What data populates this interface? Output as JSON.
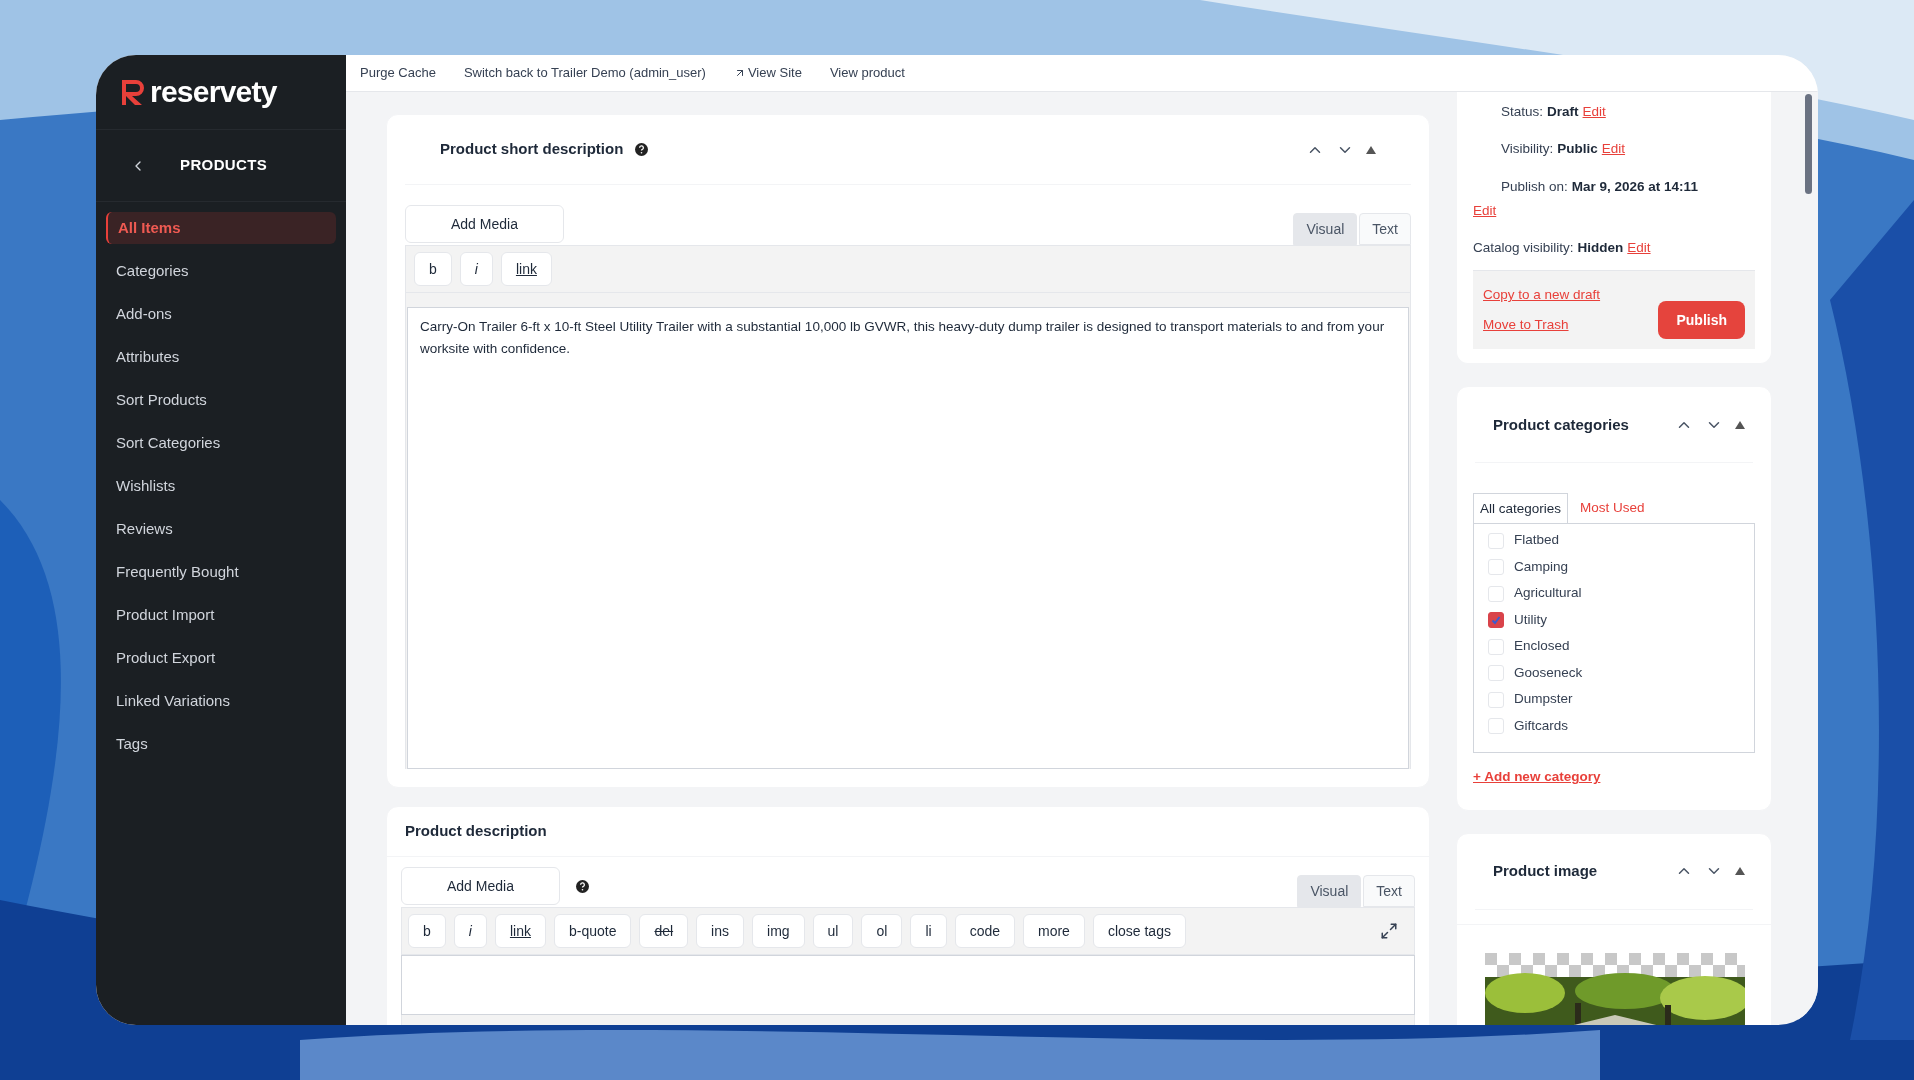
{
  "sidebar": {
    "logo": "reservety",
    "section": "PRODUCTS",
    "items": [
      {
        "label": "All Items",
        "selected": true
      },
      {
        "label": "Categories",
        "selected": false
      },
      {
        "label": "Add-ons",
        "selected": false
      },
      {
        "label": "Attributes",
        "selected": false
      },
      {
        "label": "Sort Products",
        "selected": false
      },
      {
        "label": "Sort Categories",
        "selected": false
      },
      {
        "label": "Wishlists",
        "selected": false
      },
      {
        "label": "Reviews",
        "selected": false
      },
      {
        "label": "Frequently Bought",
        "selected": false
      },
      {
        "label": "Product Import",
        "selected": false
      },
      {
        "label": "Product Export",
        "selected": false
      },
      {
        "label": "Linked Variations",
        "selected": false
      },
      {
        "label": "Tags",
        "selected": false
      }
    ]
  },
  "top_bar": {
    "links": [
      {
        "label": "Purge Cache",
        "kind": "plain"
      },
      {
        "label": "Switch back to Trailer Demo (admin_user)",
        "kind": "plain"
      },
      {
        "label": "View Site",
        "kind": "external"
      },
      {
        "label": "View product",
        "kind": "plain"
      }
    ]
  },
  "short_description": {
    "title": "Product short description",
    "add_media": "Add Media",
    "tabs": [
      {
        "label": "Visual",
        "selected": true
      },
      {
        "label": "Text",
        "selected": false
      }
    ],
    "toolbar": [
      {
        "label": "b",
        "kind": "plain"
      },
      {
        "label": "i",
        "kind": "italic"
      },
      {
        "label": "link",
        "kind": "link"
      }
    ],
    "content": "Carry-On Trailer 6-ft x 10-ft Steel Utility Trailer with a substantial 10,000 lb GVWR, this heavy-duty dump trailer is designed to transport materials to and from your worksite with confidence."
  },
  "description": {
    "title": "Product description",
    "add_media": "Add Media",
    "tabs": [
      {
        "label": "Visual",
        "selected": true
      },
      {
        "label": "Text",
        "selected": false
      }
    ],
    "toolbar": [
      {
        "label": "b",
        "kind": "plain"
      },
      {
        "label": "i",
        "kind": "italic"
      },
      {
        "label": "link",
        "kind": "link"
      },
      {
        "label": "b-quote",
        "kind": "plain"
      },
      {
        "label": "del",
        "kind": "strike"
      },
      {
        "label": "ins",
        "kind": "plain"
      },
      {
        "label": "img",
        "kind": "plain"
      },
      {
        "label": "ul",
        "kind": "plain"
      },
      {
        "label": "ol",
        "kind": "plain"
      },
      {
        "label": "li",
        "kind": "plain"
      },
      {
        "label": "code",
        "kind": "plain"
      },
      {
        "label": "more",
        "kind": "plain"
      },
      {
        "label": "close tags",
        "kind": "plain"
      }
    ]
  },
  "publish_box": {
    "rows": [
      {
        "label": "Status:",
        "value": "Draft",
        "action": "Edit",
        "indent": true,
        "action_on_new_line": false
      },
      {
        "label": "Visibility:",
        "value": "Public",
        "action": "Edit",
        "indent": true,
        "action_on_new_line": false
      },
      {
        "label": "Publish on:",
        "value": "Mar 9, 2026 at 14:11",
        "action": "Edit",
        "indent": true,
        "action_on_new_line": true
      },
      {
        "label": "Catalog visibility:",
        "value": "Hidden",
        "action": "Edit",
        "indent": false,
        "action_on_new_line": false
      }
    ],
    "copy": "Copy to a new draft",
    "trash": "Move to Trash",
    "publish": "Publish"
  },
  "categories": {
    "title": "Product categories",
    "tabs": [
      {
        "label": "All categories",
        "selected": true
      },
      {
        "label": "Most Used",
        "selected": false
      }
    ],
    "items": [
      {
        "label": "Flatbed",
        "checked": false
      },
      {
        "label": "Camping",
        "checked": false
      },
      {
        "label": "Agricultural",
        "checked": false
      },
      {
        "label": "Utility",
        "checked": true
      },
      {
        "label": "Enclosed",
        "checked": false
      },
      {
        "label": "Gooseneck",
        "checked": false
      },
      {
        "label": "Dumpster",
        "checked": false
      },
      {
        "label": "Giftcards",
        "checked": false
      }
    ],
    "add_link": "+ Add new category"
  },
  "product_image": {
    "title": "Product image"
  }
}
